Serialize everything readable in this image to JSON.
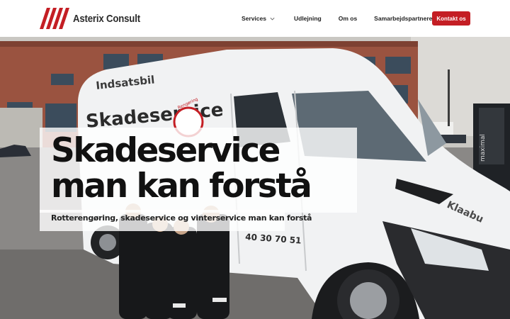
{
  "header": {
    "logo_text": "Asterix Consult",
    "nav": [
      {
        "label": "Services",
        "has_dropdown": true
      },
      {
        "label": "Udlejning"
      },
      {
        "label": "Om os"
      },
      {
        "label": "Samarbejdspartnere"
      }
    ],
    "cta_label": "Kontakt os"
  },
  "hero": {
    "title": "Skadeservice man kan forstå",
    "subtitle": "Rotterengøring, skadeservice og vinterservice man kan forstå",
    "van_texts": {
      "rear_label": "Indsatsbil",
      "side_label": "Skadeservice",
      "badge": "Rengøring",
      "phone": "40 30 70 51",
      "front_label": "Klaabu",
      "forklift": "maximal"
    }
  },
  "colors": {
    "accent": "#c41e24",
    "text_dark": "#111111",
    "panel": "rgba(255,255,255,0.80)"
  },
  "icons": {
    "dropdown": "chevron-down-icon",
    "logo_mark": "logo-stripes-icon"
  }
}
